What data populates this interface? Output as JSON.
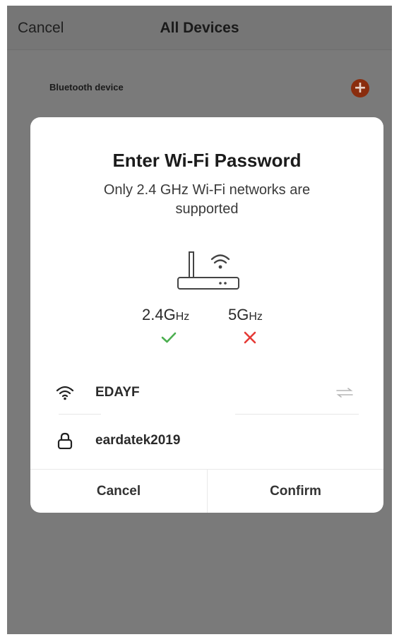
{
  "nav": {
    "cancel_label": "Cancel",
    "title": "All Devices"
  },
  "background": {
    "bluetooth_label": "Bluetooth device",
    "add_icon": "plus-circle-icon",
    "add_color": "#8a2d0e"
  },
  "dialog": {
    "title": "Enter Wi-Fi Password",
    "subtitle": "Only 2.4 GHz Wi-Fi networks are supported",
    "router_icon": "router-wifi-icon",
    "bands": [
      {
        "value": "2.4",
        "unit": "Hz",
        "prefix": "G",
        "supported": true,
        "mark_color": "#4caf50"
      },
      {
        "value": "5",
        "unit": "Hz",
        "prefix": "G",
        "supported": false,
        "mark_color": "#e53935"
      }
    ],
    "ssid": "EDAYF",
    "password": "eardatek2019",
    "cancel_label": "Cancel",
    "confirm_label": "Confirm"
  }
}
